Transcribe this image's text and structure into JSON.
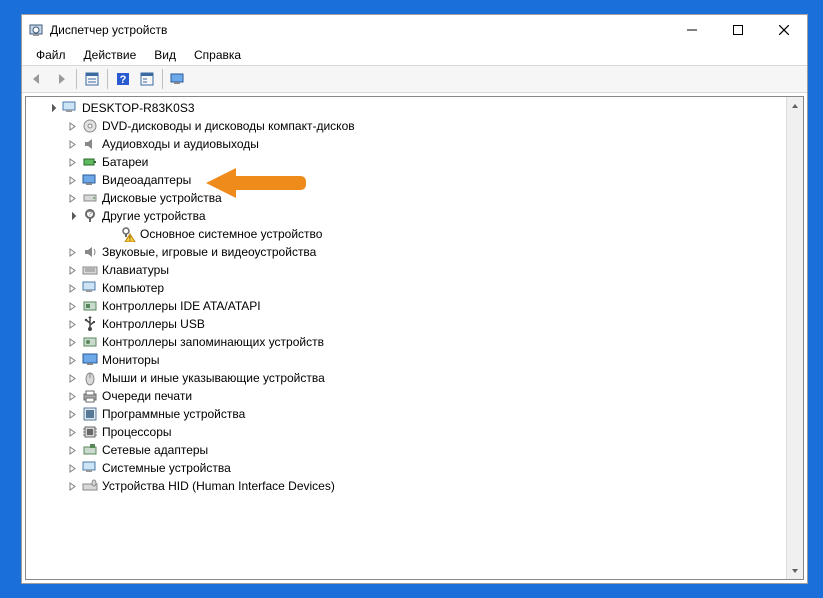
{
  "window": {
    "title": "Диспетчер устройств"
  },
  "menu": {
    "file": "Файл",
    "action": "Действие",
    "view": "Вид",
    "help": "Справка"
  },
  "tree": {
    "root": "DESKTOP-R83K0S3",
    "items": [
      {
        "label": "DVD-дисководы и дисководы компакт-дисков"
      },
      {
        "label": "Аудиовходы и аудиовыходы"
      },
      {
        "label": "Батареи"
      },
      {
        "label": "Видеоадаптеры"
      },
      {
        "label": "Дисковые устройства"
      },
      {
        "label": "Другие устройства",
        "expanded": true,
        "children": [
          {
            "label": "Основное системное устройство"
          }
        ]
      },
      {
        "label": "Звуковые, игровые и видеоустройства"
      },
      {
        "label": "Клавиатуры"
      },
      {
        "label": "Компьютер"
      },
      {
        "label": "Контроллеры IDE ATA/ATAPI"
      },
      {
        "label": "Контроллеры USB"
      },
      {
        "label": "Контроллеры запоминающих устройств"
      },
      {
        "label": "Мониторы"
      },
      {
        "label": "Мыши и иные указывающие устройства"
      },
      {
        "label": "Очереди печати"
      },
      {
        "label": "Программные устройства"
      },
      {
        "label": "Процессоры"
      },
      {
        "label": "Сетевые адаптеры"
      },
      {
        "label": "Системные устройства"
      },
      {
        "label": "Устройства HID (Human Interface Devices)"
      }
    ]
  },
  "icons": {
    "back": "back-icon",
    "forward": "forward-icon",
    "properties": "properties-icon",
    "help": "help-icon",
    "scan": "scan-icon",
    "computer": "computer-icon"
  }
}
